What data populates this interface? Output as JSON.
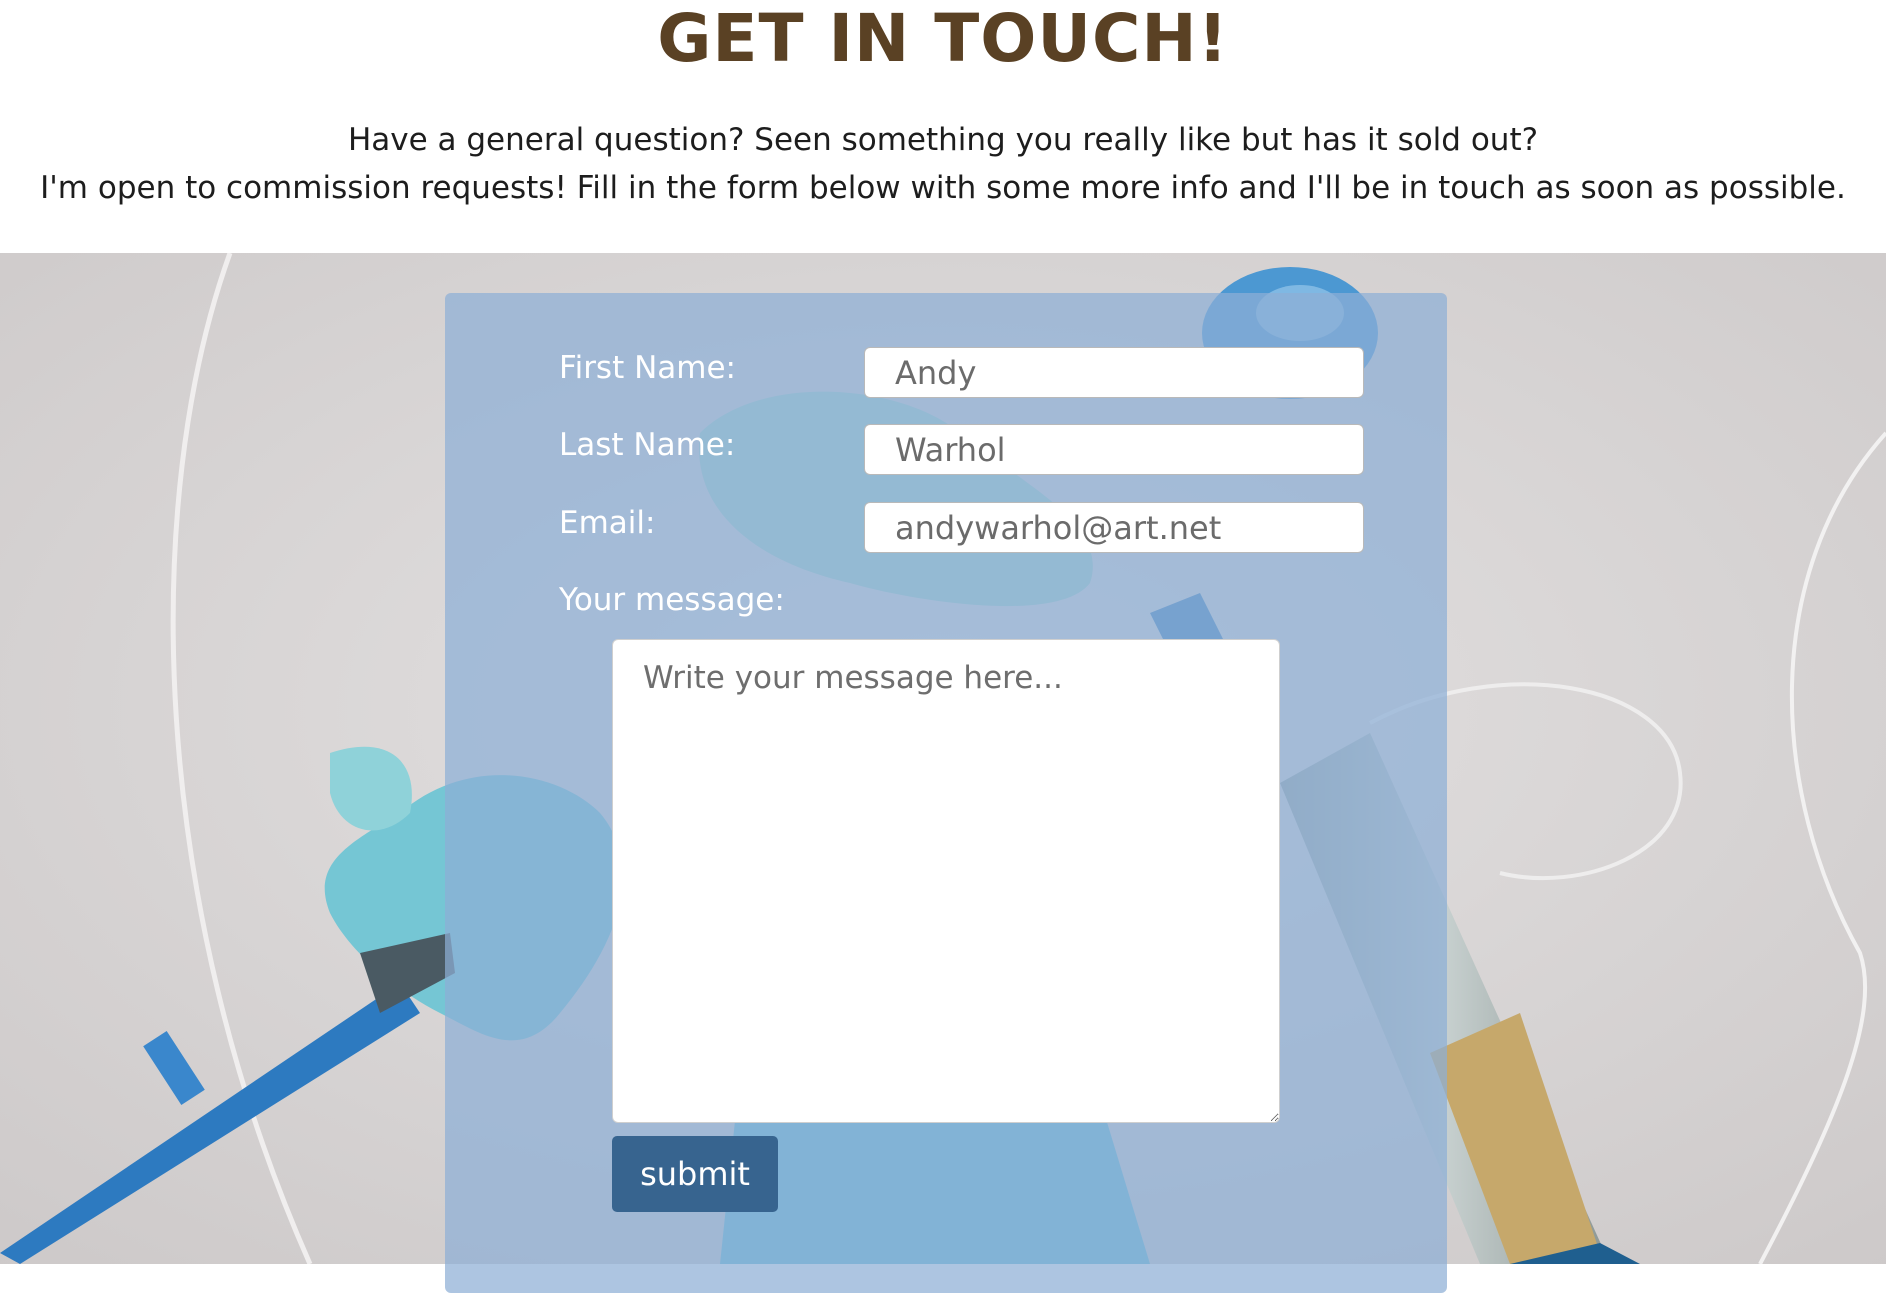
{
  "header": {
    "title": "GET IN TOUCH!",
    "intro_line_1": "Have a general question? Seen something you really like but has it sold out?",
    "intro_line_2": "I'm open to commission requests! Fill in the form below with some more info and I'll be in touch as soon as possible."
  },
  "form": {
    "first_name_label": "First Name:",
    "first_name_value": "Andy",
    "last_name_label": "Last Name:",
    "last_name_value": "Warhol",
    "email_label": "Email:",
    "email_value": "andywarhol@art.net",
    "message_label": "Your message:",
    "message_placeholder": "Write your message here...",
    "submit_label": "submit"
  },
  "colors": {
    "title": "#5a4124",
    "panel": "#8dafd5",
    "submit": "#37648f"
  }
}
